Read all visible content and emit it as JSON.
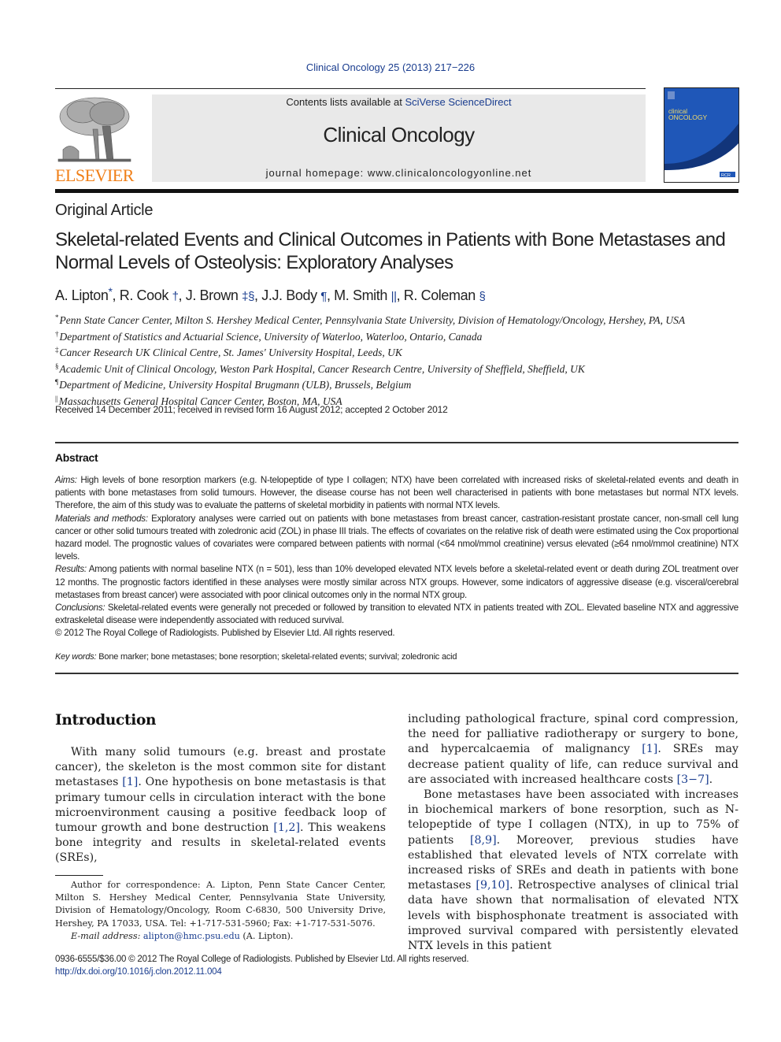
{
  "header": {
    "journal_reference": "Clinical Oncology 25 (2013) 217−226",
    "contents_prefix": "Contents lists available at ",
    "contents_link": "SciVerse ScienceDirect",
    "journal_title": "Clinical Oncology",
    "homepage": "journal homepage: www.clinicaloncologyonline.net",
    "publisher_logo_text": "ELSEVIER",
    "publisher_logo_icon": "elsevier-tree-icon",
    "cover": {
      "title_line1": "clinical",
      "title_line2": "ONCOLOGY",
      "badge": "RCR",
      "colors": {
        "primary": "#1f57b8",
        "dark": "#12357a",
        "title": "#f1d96a"
      }
    },
    "colors": {
      "link": "#1a3d8f",
      "logo": "#f07f17",
      "masthead_bg": "#e9e9e9"
    }
  },
  "article": {
    "type": "Original Article",
    "title": "Skeletal-related Events and Clinical Outcomes in Patients with Bone Metastases and Normal Levels of Osteolysis: Exploratory Analyses",
    "authors": [
      {
        "name": "A. Lipton",
        "marks": "*"
      },
      {
        "name": "R. Cook",
        "marks": "†"
      },
      {
        "name": "J. Brown",
        "marks": "‡§"
      },
      {
        "name": "J.J. Body",
        "marks": "¶"
      },
      {
        "name": "M. Smith",
        "marks": "||"
      },
      {
        "name": "R. Coleman",
        "marks": "§"
      }
    ],
    "affiliations": [
      {
        "mark": "*",
        "text": "Penn State Cancer Center, Milton S. Hershey Medical Center, Pennsylvania State University, Division of Hematology/Oncology, Hershey, PA, USA"
      },
      {
        "mark": "†",
        "text": "Department of Statistics and Actuarial Science, University of Waterloo, Waterloo, Ontario, Canada"
      },
      {
        "mark": "‡",
        "text": "Cancer Research UK Clinical Centre, St. James' University Hospital, Leeds, UK"
      },
      {
        "mark": "§",
        "text": "Academic Unit of Clinical Oncology, Weston Park Hospital, Cancer Research Centre, University of Sheffield, Sheffield, UK"
      },
      {
        "mark": "¶",
        "text": "Department of Medicine, University Hospital Brugmann (ULB), Brussels, Belgium"
      },
      {
        "mark": "||",
        "text": "Massachusetts General Hospital Cancer Center, Boston, MA, USA"
      }
    ],
    "received": "Received 14 December 2011; received in revised form 16 August 2012; accepted 2 October 2012"
  },
  "abstract": {
    "heading": "Abstract",
    "sections": [
      {
        "label": "Aims:",
        "text": " High levels of bone resorption markers (e.g. N-telopeptide of type I collagen; NTX) have been correlated with increased risks of skeletal-related events and death in patients with bone metastases from solid tumours. However, the disease course has not been well characterised in patients with bone metastases but normal NTX levels. Therefore, the aim of this study was to evaluate the patterns of skeletal morbidity in patients with normal NTX levels."
      },
      {
        "label": "Materials and methods:",
        "text": " Exploratory analyses were carried out on patients with bone metastases from breast cancer, castration-resistant prostate cancer, non-small cell lung cancer or other solid tumours treated with zoledronic acid (ZOL) in phase III trials. The effects of covariates on the relative risk of death were estimated using the Cox proportional hazard model. The prognostic values of covariates were compared between patients with normal (<64 nmol/mmol creatinine) versus elevated (≥64 nmol/mmol creatinine) NTX levels."
      },
      {
        "label": "Results:",
        "text": " Among patients with normal baseline NTX (n = 501), less than 10% developed elevated NTX levels before a skeletal-related event or death during ZOL treatment over 12 months. The prognostic factors identified in these analyses were mostly similar across NTX groups. However, some indicators of aggressive disease (e.g. visceral/cerebral metastases from breast cancer) were associated with poor clinical outcomes only in the normal NTX group."
      },
      {
        "label": "Conclusions:",
        "text": " Skeletal-related events were generally not preceded or followed by transition to elevated NTX in patients treated with ZOL. Elevated baseline NTX and aggressive extraskeletal disease were independently associated with reduced survival."
      }
    ],
    "copyright": "© 2012 The Royal College of Radiologists. Published by Elsevier Ltd. All rights reserved.",
    "keywords_label": "Key words:",
    "keywords": " Bone marker; bone metastases; bone resorption; skeletal-related events; survival; zoledronic acid"
  },
  "body": {
    "intro_heading": "Introduction",
    "left_column": [
      {
        "t": "With many solid tumours (e.g. breast and prostate cancer), the skeleton is the most common site for distant metastases "
      },
      {
        "ref": "[1]"
      },
      {
        "t": ". One hypothesis on bone metastasis is that primary tumour cells in circulation interact with the bone microenvironment causing a positive feedback loop of tumour growth and bone destruction "
      },
      {
        "ref": "[1,2]"
      },
      {
        "t": ". This weakens bone integrity and results in skeletal-related events (SREs),"
      }
    ],
    "right_para1": [
      {
        "t": "including pathological fracture, spinal cord compression, the need for palliative radiotherapy or surgery to bone, and hypercalcaemia of malignancy "
      },
      {
        "ref": "[1]"
      },
      {
        "t": ". SREs may decrease patient quality of life, can reduce survival and are associated with increased healthcare costs "
      },
      {
        "ref": "[3−7]"
      },
      {
        "t": "."
      }
    ],
    "right_para2": [
      {
        "t": "Bone metastases have been associated with increases in biochemical markers of bone resorption, such as N-telopeptide of type I collagen (NTX), in up to 75% of patients "
      },
      {
        "ref": "[8,9]"
      },
      {
        "t": ". Moreover, previous studies have established that elevated levels of NTX correlate with increased risks of SREs and death in patients with bone metastases "
      },
      {
        "ref": "[9,10]"
      },
      {
        "t": ". Retrospective analyses of clinical trial data have shown that normalisation of elevated NTX levels with bisphosphonate treatment is associated with improved survival compared with persistently elevated NTX levels in this patient"
      }
    ]
  },
  "footnote": {
    "correspondence": "Author for correspondence: A. Lipton, Penn State Cancer Center, Milton S. Hershey Medical Center, Pennsylvania State University, Division of Hematology/Oncology, Room C-6830, 500 University Drive, Hershey, PA 17033, USA. Tel: +1-717-531-5960; Fax: +1-717-531-5076.",
    "email_label": "E-mail address:",
    "email": "alipton@hmc.psu.edu",
    "email_suffix": " (A. Lipton)."
  },
  "bottom": {
    "issn_line": "0936-6555/$36.00 © 2012 The Royal College of Radiologists. Published by Elsevier Ltd. All rights reserved.",
    "doi": "http://dx.doi.org/10.1016/j.clon.2012.11.004"
  }
}
